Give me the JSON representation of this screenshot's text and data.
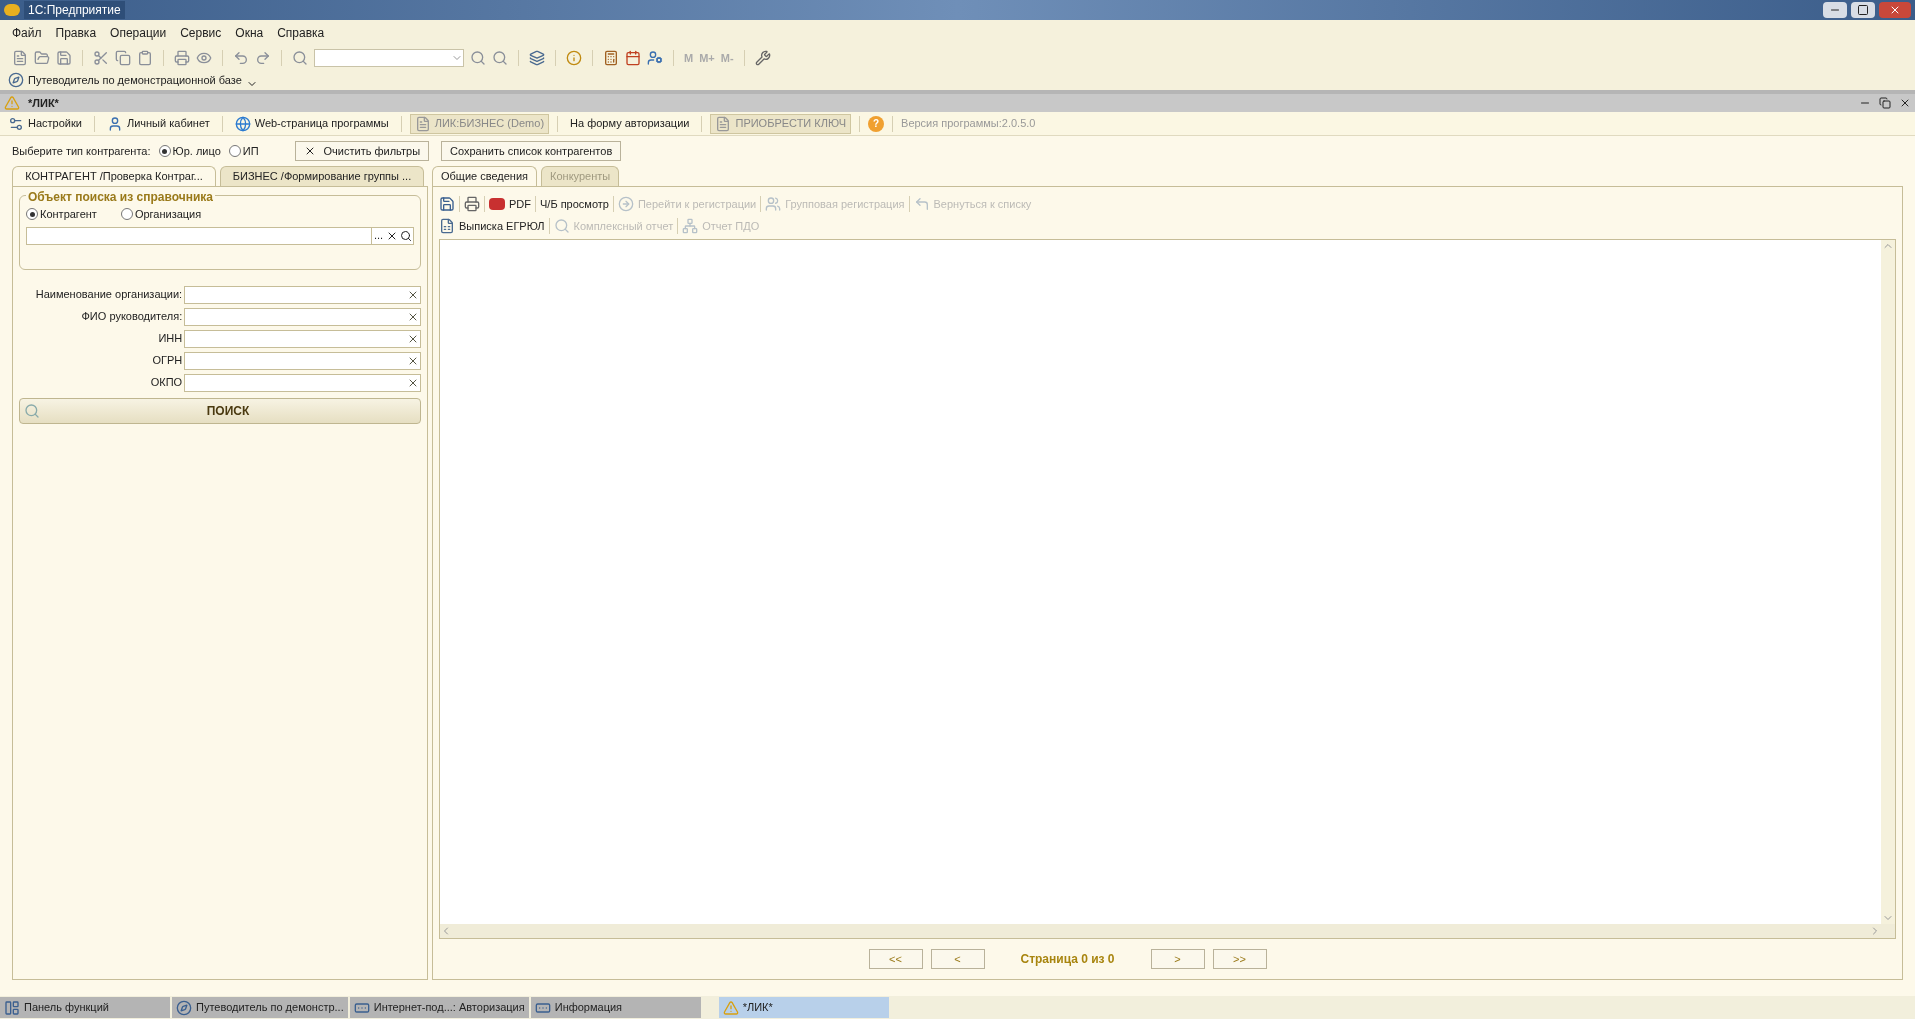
{
  "app_title": "1С:Предприятие",
  "menu": [
    "Файл",
    "Правка",
    "Операции",
    "Сервис",
    "Окна",
    "Справка"
  ],
  "toolbar_letters": [
    "M",
    "M+",
    "M-"
  ],
  "guide": {
    "label": "Путеводитель по демонстрационной базе"
  },
  "document": {
    "title": "*ЛИК*"
  },
  "doc_toolbar": [
    {
      "kind": "link",
      "label": "Настройки"
    },
    {
      "kind": "link",
      "label": "Личный кабинет"
    },
    {
      "kind": "link",
      "label": "Web-страница программы"
    },
    {
      "kind": "boxed",
      "label": "ЛИК:БИЗНЕС (Demo)"
    },
    {
      "kind": "link",
      "label": "На форму авторизации"
    },
    {
      "kind": "boxed",
      "label": "ПРИОБРЕСТИ КЛЮЧ"
    },
    {
      "kind": "help",
      "label": "?"
    },
    {
      "kind": "text",
      "label": "Версия программы:2.0.5.0"
    }
  ],
  "contractor_type": {
    "label": "Выберите тип контрагента:",
    "options": [
      {
        "label": "Юр. лицо",
        "selected": true
      },
      {
        "label": "ИП",
        "selected": false
      }
    ]
  },
  "filter_buttons": [
    {
      "label": "Очистить фильтры"
    },
    {
      "label": "Сохранить список контрагентов"
    }
  ],
  "left_tabs": [
    {
      "label": "КОНТРАГЕНТ /Проверка Контраг...",
      "selected": true
    },
    {
      "label": "БИЗНЕС /Формирование группы ...",
      "selected": false
    }
  ],
  "search_group": {
    "title": "Объект поиска из справочника",
    "options": [
      {
        "label": "Контрагент",
        "selected": true
      },
      {
        "label": "Организация",
        "selected": false
      }
    ],
    "field": {
      "dots": "..."
    }
  },
  "fields": [
    {
      "label": "Наименование организации:"
    },
    {
      "label": "ФИО руководителя:"
    },
    {
      "label": "ИНН"
    },
    {
      "label": "ОГРН"
    },
    {
      "label": "ОКПО"
    }
  ],
  "search_button": {
    "label": "ПОИСК"
  },
  "right_tabs": [
    {
      "label": "Общие сведения",
      "selected": true
    },
    {
      "label": "Конкуренты",
      "selected": false
    }
  ],
  "report_toolbar": [
    [
      {
        "disabled": false
      },
      {
        "disabled": false
      },
      {
        "label": "PDF",
        "disabled": false
      },
      {
        "label": "Ч/Б  просмотр",
        "disabled": false
      },
      {
        "label": "Перейти к регистрации",
        "disabled": true
      },
      {
        "label": "Групповая регистрация",
        "disabled": true
      },
      {
        "label": "Вернуться к списку",
        "disabled": true
      }
    ],
    [
      {
        "label": "Выписка ЕГРЮЛ",
        "disabled": false
      },
      {
        "label": "Комплексный отчет",
        "disabled": true
      },
      {
        "label": "Отчет ПДО",
        "disabled": true
      }
    ]
  ],
  "pager": {
    "first": "<<",
    "prev": "<",
    "text": "Страница 0 из 0",
    "next": ">",
    "last": ">>"
  },
  "taskbar": [
    {
      "label": "Панель функций",
      "selected": false
    },
    {
      "label": "Путеводитель по демонстр...",
      "selected": false
    },
    {
      "label": "Интернет-под...: Авторизация",
      "selected": false
    },
    {
      "label": "Информация",
      "selected": false
    },
    {
      "label": "*ЛИК*",
      "selected": true
    }
  ]
}
